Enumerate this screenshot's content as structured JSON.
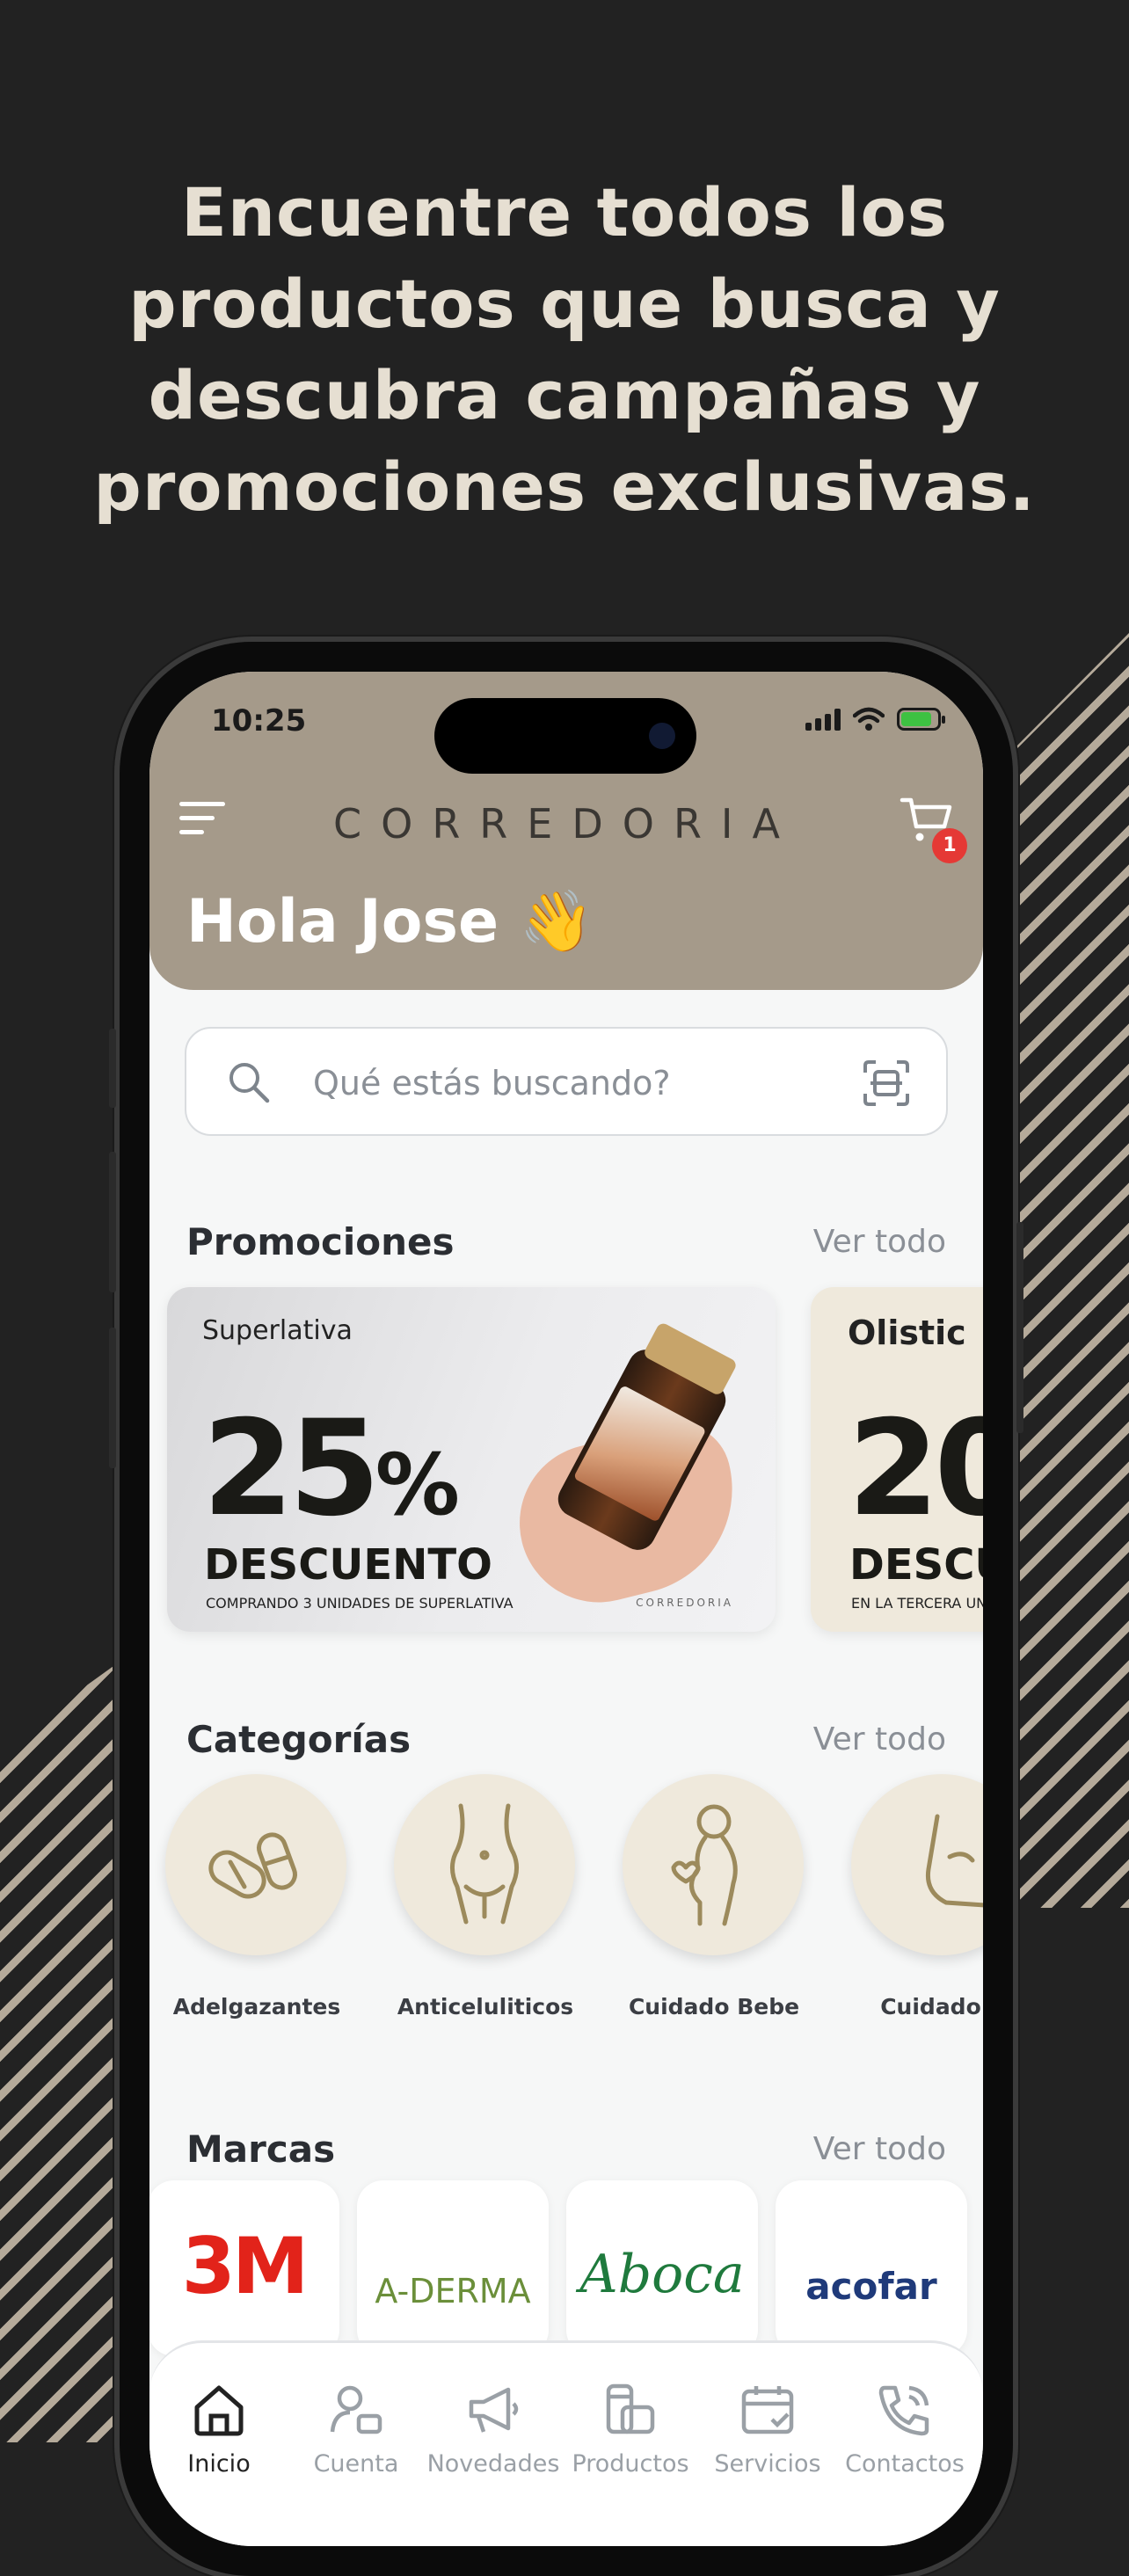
{
  "headline": [
    "Encuentre todos los",
    "productos que busca y",
    "descubra campañas y",
    "promociones exclusivas."
  ],
  "status": {
    "time": "10:25"
  },
  "header": {
    "brand": "CORREDORIA",
    "cart_count": "1",
    "greeting": "Hola Jose 👋"
  },
  "search": {
    "placeholder": "Qué estás buscando?"
  },
  "promotions": {
    "title": "Promociones",
    "see_all": "Ver todo",
    "cards": [
      {
        "brand": "Superlativa",
        "percent": "25",
        "percent_sign": "%",
        "label": "DESCUENTO",
        "sub": "COMPRANDO 3 UNIDADES DE SUPERLATIVA",
        "mark": "CORREDORIA"
      },
      {
        "brand": "Olistic",
        "percent": "20",
        "label": "DESCU",
        "sub": "EN LA TERCERA UN"
      }
    ]
  },
  "categories": {
    "title": "Categorías",
    "see_all": "Ver todo",
    "items": [
      {
        "label": "Adelgazantes"
      },
      {
        "label": "Anticeluliticos"
      },
      {
        "label": "Cuidado Bebe"
      },
      {
        "label": "Cuidado P"
      }
    ]
  },
  "brands": {
    "title": "Marcas",
    "see_all": "Ver todo",
    "items": [
      {
        "name": "3M",
        "color": "#e2231a"
      },
      {
        "name": "A-DERMA",
        "color": "#6b8f3a"
      },
      {
        "name": "Aboca",
        "color": "#1f7a3d"
      },
      {
        "name": "acofar",
        "color": "#1f3a7a"
      }
    ]
  },
  "tabbar": {
    "items": [
      {
        "label": "Inicio",
        "icon": "home-icon"
      },
      {
        "label": "Cuenta",
        "icon": "user-icon"
      },
      {
        "label": "Novedades",
        "icon": "megaphone-icon"
      },
      {
        "label": "Productos",
        "icon": "products-icon"
      },
      {
        "label": "Servicios",
        "icon": "calendar-icon"
      },
      {
        "label": "Contactos",
        "icon": "phone-icon"
      }
    ]
  },
  "colors": {
    "background": "#222222",
    "header": "#a59a8a",
    "accent": "#9c8a5c",
    "badge": "#e53935"
  }
}
